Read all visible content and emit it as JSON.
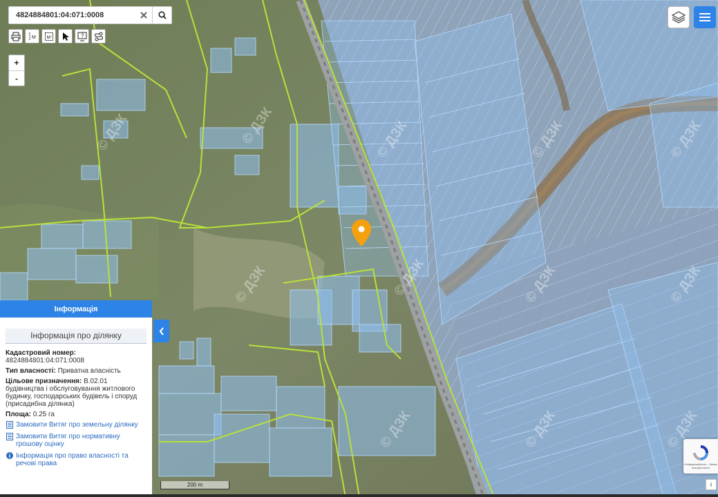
{
  "search": {
    "value": "4824884801:04:071:0008",
    "clear_icon": "clear-icon",
    "search_icon": "search-icon"
  },
  "tools": [
    "print-icon",
    "measure-distance-icon",
    "measure-area-icon",
    "select-pointer-icon",
    "identify-icon",
    "route-icon"
  ],
  "zoom": {
    "in_label": "+",
    "out_label": "-"
  },
  "panel": {
    "header": "Інформація",
    "subtitle": "Інформація про ділянку",
    "cadastral_label": "Кадастровий номер:",
    "cadastral_value": "4824884801:04:071:0008",
    "ownership_label": "Тип власності:",
    "ownership_value": "Приватна власність",
    "purpose_label": "Цільове призначення:",
    "purpose_value": "В.02.01 будівництва і обслуговування житлового будинку, господарських будівель і споруд (присадибна ділянка)",
    "area_label": "Площа:",
    "area_value": "0.25 га",
    "links": [
      "Замовити Витяг про земельну ділянку",
      "Замовити Витяг про нормативну грошову оцінку",
      "Інформація про право власності та речові права"
    ]
  },
  "scale": {
    "label": "200 m"
  },
  "watermark": "© ДЗК",
  "recaptcha": {
    "text": "Конфіденційність - Умови використання"
  },
  "info_button": "i",
  "colors": {
    "accent": "#2e83e6",
    "parcel": "#7fb9f0",
    "boundary": "#b8e23a",
    "marker": "#f5a00f"
  }
}
